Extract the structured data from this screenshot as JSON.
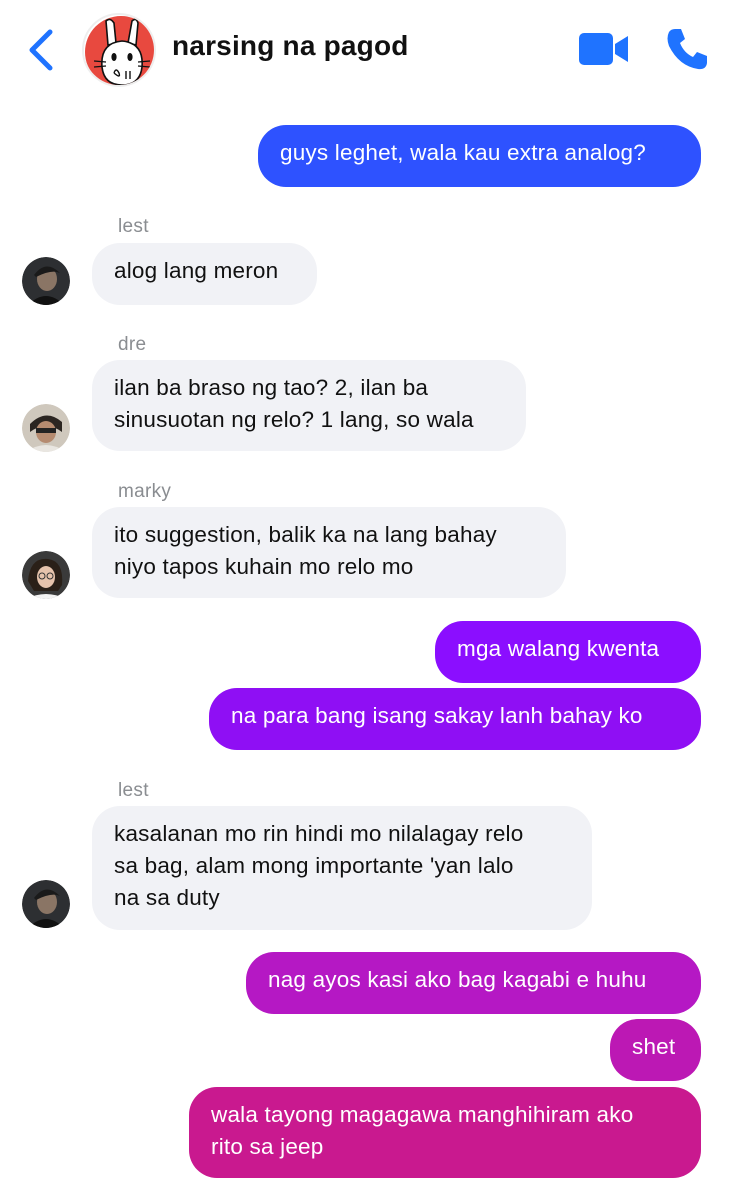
{
  "header": {
    "title": "narsing na pagod"
  },
  "messages": [
    {
      "text": "guys leghet, wala kau extra analog?"
    },
    {
      "sender": "lest",
      "text": "alog lang meron"
    },
    {
      "sender": "dre",
      "line1": "ilan ba braso ng tao? 2, ilan ba",
      "line2": "sinusuotan ng relo? 1 lang, so wala"
    },
    {
      "sender": "marky",
      "line1": "ito suggestion, balik ka na lang bahay",
      "line2": "niyo tapos kuhain mo relo mo"
    },
    {
      "text": "mga walang kwenta"
    },
    {
      "text": "na para bang isang sakay lanh bahay ko"
    },
    {
      "sender": "lest",
      "line1": "kasalanan mo rin hindi mo nilalagay relo",
      "line2": "sa bag, alam mong importante 'yan lalo",
      "line3": "na sa duty"
    },
    {
      "text": "nag ayos kasi ako bag kagabi e huhu"
    },
    {
      "text": "shet"
    },
    {
      "line1": "wala tayong magagawa manghihiram ako",
      "line2": "rito sa jeep"
    }
  ],
  "colors": {
    "accent": "#1f73ff",
    "incoming_bubble": "#f1f2f6",
    "sender_label": "#8a8d91",
    "out_blue": "#2e52ff",
    "out_purple": "#8b0eff",
    "out_magenta": "#b518c4",
    "out_pink": "#c9198f"
  },
  "icons": [
    "back-chevron-icon",
    "video-camera-icon",
    "phone-icon"
  ]
}
